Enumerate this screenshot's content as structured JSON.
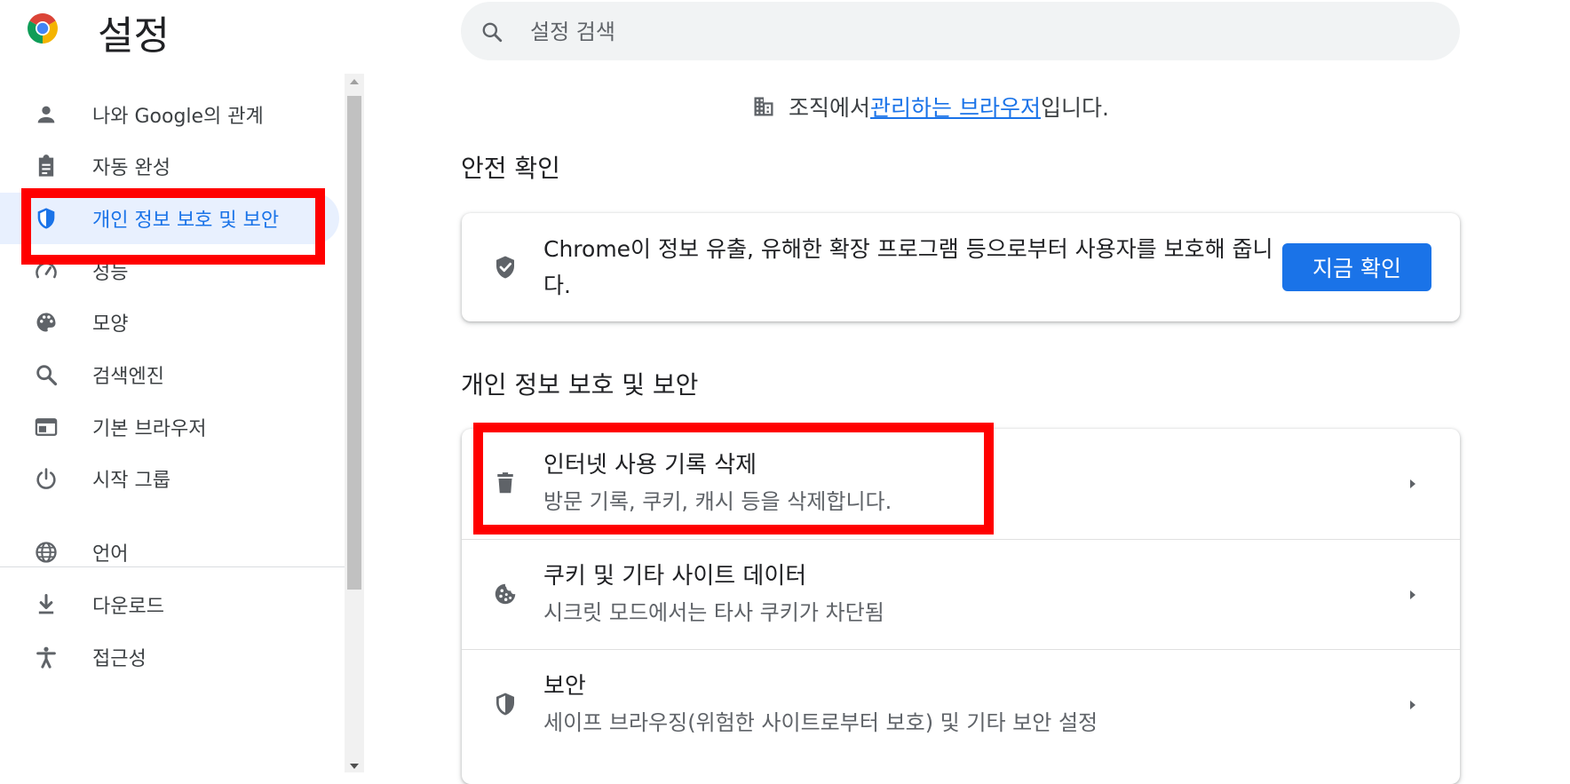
{
  "header": {
    "title": "설정",
    "search_placeholder": "설정 검색",
    "logo_icon": "chrome-logo-icon"
  },
  "sidebar": {
    "items": [
      {
        "label": "나와 Google의 관계",
        "icon": "person-icon"
      },
      {
        "label": "자동 완성",
        "icon": "clipboard-icon"
      },
      {
        "label": "개인 정보 보호 및 보안",
        "icon": "shield-icon",
        "active": true
      },
      {
        "label": "성능",
        "icon": "speedometer-icon"
      },
      {
        "label": "모양",
        "icon": "palette-icon"
      },
      {
        "label": "검색엔진",
        "icon": "search-icon"
      },
      {
        "label": "기본 브라우저",
        "icon": "browser-window-icon"
      },
      {
        "label": "시작 그룹",
        "icon": "power-icon"
      },
      {
        "label": "언어",
        "icon": "globe-icon"
      },
      {
        "label": "다운로드",
        "icon": "download-icon"
      },
      {
        "label": "접근성",
        "icon": "accessibility-icon"
      }
    ]
  },
  "managed_notice": {
    "prefix": "조직에서 ",
    "link": "관리하는 브라우저",
    "suffix": "입니다.",
    "icon": "building-icon"
  },
  "safety_check": {
    "title": "안전 확인",
    "description": "Chrome이 정보 유출, 유해한 확장 프로그램 등으로부터 사용자를 보호해 줍니다.",
    "button": "지금 확인",
    "icon": "shield-check-icon"
  },
  "privacy": {
    "title": "개인 정보 보호 및 보안",
    "rows": [
      {
        "title": "인터넷 사용 기록 삭제",
        "description": "방문 기록, 쿠키, 캐시 등을 삭제합니다.",
        "icon": "trash-icon"
      },
      {
        "title": "쿠키 및 기타 사이트 데이터",
        "description": "시크릿 모드에서는 타사 쿠키가 차단됨",
        "icon": "cookie-icon"
      },
      {
        "title": "보안",
        "description": "세이프 브라우징(위험한 사이트로부터 보호) 및 기타 보안 설정",
        "icon": "shield-icon"
      }
    ]
  },
  "colors": {
    "accent": "#1a73e8",
    "active_bg": "#e8f0fe",
    "highlight": "#ff0000",
    "icon_gray": "#5f6368"
  }
}
